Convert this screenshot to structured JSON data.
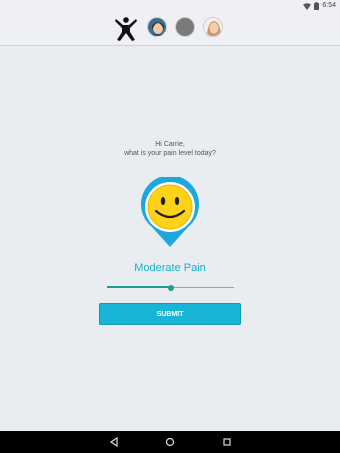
{
  "status_bar": {
    "time": "6:54",
    "icons": [
      "wifi-icon",
      "battery-icon"
    ]
  },
  "header": {
    "logo": "person-logo",
    "avatars": [
      {
        "name": "avatar-1",
        "kind": "photo",
        "color": "#3a6f8f"
      },
      {
        "name": "avatar-2",
        "kind": "placeholder",
        "color": "#7a7a7a"
      },
      {
        "name": "avatar-3",
        "kind": "photo",
        "color": "#c9996b"
      }
    ]
  },
  "main": {
    "greeting_line1": "Hi Carrie,",
    "greeting_line2": "what is your pain level today?",
    "pain_icon": "smiley-pin-icon",
    "pain_label": "Moderate Pain",
    "slider": {
      "value_fraction": 0.5
    },
    "submit_label": "SUBMIT"
  },
  "colors": {
    "accent": "#1aaed0",
    "button": "#19b5d6",
    "slider": "#1b9e8e",
    "pin": "#1ba8dd",
    "face": "#ffd21a"
  },
  "nav": {
    "icons": [
      "back-icon",
      "home-icon",
      "recents-icon"
    ]
  }
}
